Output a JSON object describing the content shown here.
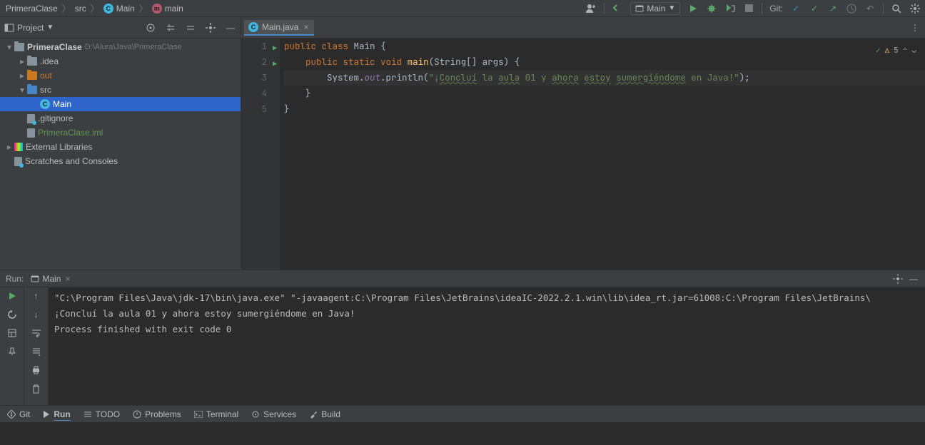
{
  "breadcrumb": {
    "project": "PrimeraClase",
    "src": "src",
    "main_class": "Main",
    "main_method": "main"
  },
  "toolbar": {
    "run_config": "Main",
    "git_label": "Git:"
  },
  "project": {
    "title": "Project",
    "root": "PrimeraClase",
    "root_path": "D:\\Alura\\Java\\PrimeraClase",
    "idea": ".idea",
    "out": "out",
    "src": "src",
    "main": "Main",
    "gitignore": ".gitignore",
    "iml": "PrimeraClase.iml",
    "external": "External Libraries",
    "scratches": "Scratches and Consoles"
  },
  "editor": {
    "tab": "Main.java",
    "inspections": "5",
    "code": {
      "l1_public": "public ",
      "l1_class": "class ",
      "l1_name": "Main {",
      "l2_indent": "    ",
      "l2_public": "public ",
      "l2_static": "static ",
      "l2_void": "void ",
      "l2_main": "main",
      "l2_params": "(String[] args) {",
      "l3_indent": "        System.",
      "l3_out": "out",
      "l3_println": ".println(",
      "l3_str1": "\"¡",
      "l3_w1": "Concluí",
      "l3_s1": " la ",
      "l3_w2": "aula",
      "l3_s2": " 01 y ",
      "l3_w3": "ahora",
      "l3_s3": " ",
      "l3_w4": "estoy",
      "l3_s4": " ",
      "l3_w5": "sumergiéndome",
      "l3_s5": " en Java!\"",
      "l3_end": ");",
      "l4": "    }",
      "l5": "}"
    }
  },
  "run": {
    "label": "Run:",
    "tab": "Main",
    "console_l1": "\"C:\\Program Files\\Java\\jdk-17\\bin\\java.exe\" \"-javaagent:C:\\Program Files\\JetBrains\\ideaIC-2022.2.1.win\\lib\\idea_rt.jar=61008:C:\\Program Files\\JetBrains\\",
    "console_l2": "¡Concluí la aula 01 y ahora estoy sumergiéndome en Java!",
    "console_l3": "",
    "console_l4": "Process finished with exit code 0"
  },
  "bottom": {
    "git": "Git",
    "run": "Run",
    "todo": "TODO",
    "problems": "Problems",
    "terminal": "Terminal",
    "services": "Services",
    "build": "Build"
  }
}
